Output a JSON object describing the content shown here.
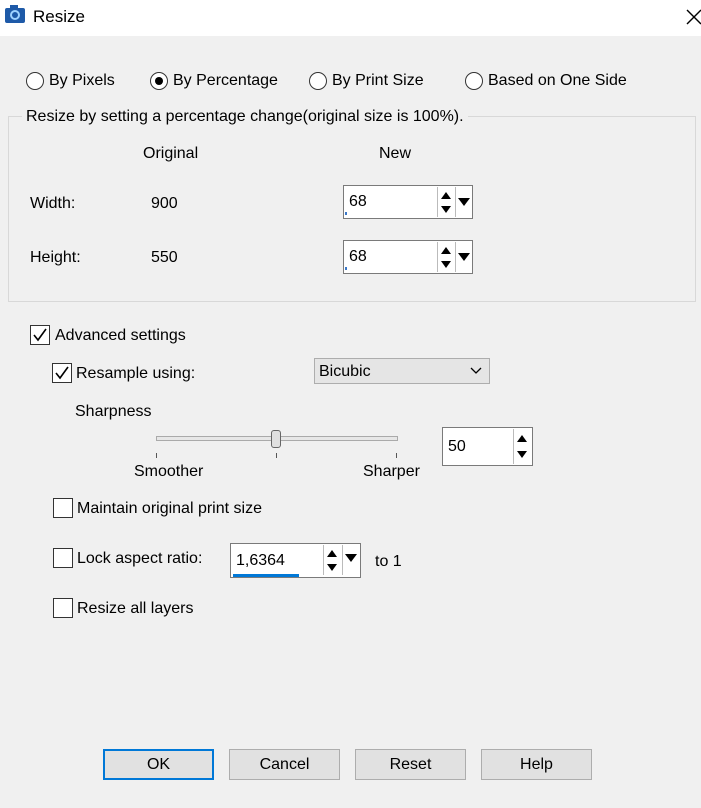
{
  "window": {
    "title": "Resize"
  },
  "mode_options": [
    "By Pixels",
    "By Percentage",
    "By Print Size",
    "Based on One Side"
  ],
  "selected_mode": "By Percentage",
  "group_caption": "Resize by setting a percentage change(original size is 100%).",
  "table": {
    "original_header": "Original",
    "new_header": "New",
    "width_label": "Width:",
    "width_original": "900",
    "width_new": "68",
    "height_label": "Height:",
    "height_original": "550",
    "height_new": "68"
  },
  "advanced": {
    "label": "Advanced settings",
    "checked": true,
    "resample_label": "Resample using:",
    "resample_checked": true,
    "resample_value": "Bicubic",
    "sharpness_label": "Sharpness",
    "smoother_label": "Smoother",
    "sharper_label": "Sharper",
    "sharpness_value": "50",
    "maintain_print_label": "Maintain original print size",
    "maintain_print_checked": false,
    "lock_aspect_label": "Lock aspect ratio:",
    "lock_aspect_checked": false,
    "aspect_value": "1,6364",
    "aspect_suffix": "to 1",
    "resize_layers_label": "Resize all layers",
    "resize_layers_checked": false
  },
  "buttons": {
    "ok": "OK",
    "cancel": "Cancel",
    "reset": "Reset",
    "help": "Help"
  },
  "colors": {
    "accent": "#0078d7",
    "window_bg": "#f0f0f0"
  }
}
